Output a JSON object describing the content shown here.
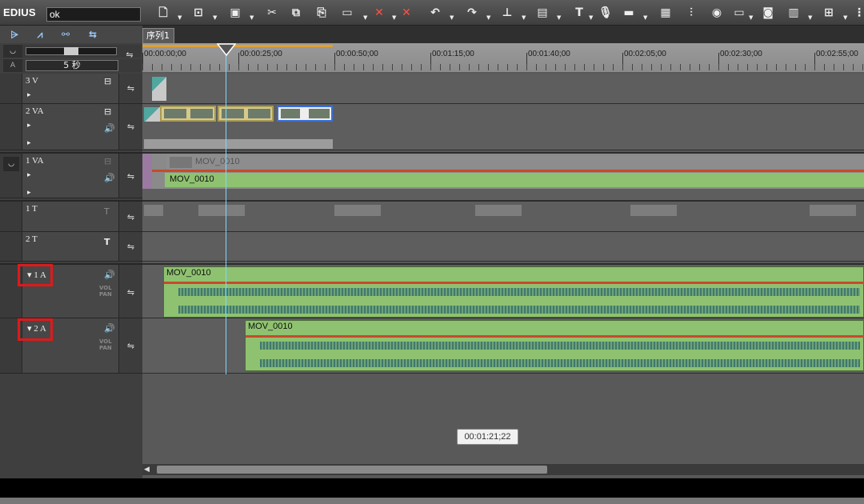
{
  "app": {
    "title": "EDIUS",
    "project_name": "ok"
  },
  "toolbar": {
    "icons": [
      "new-icon",
      "open-icon",
      "save-icon",
      "cut-icon",
      "copy-icon",
      "paste-icon",
      "clip-icon",
      "delete-gap-icon",
      "ripple-delete-icon",
      "undo-icon",
      "redo-icon",
      "marker-icon",
      "render-icon",
      "title-icon",
      "mic-icon",
      "monitor-icon",
      "grid-icon",
      "mixer-icon",
      "color-icon",
      "layout-icon",
      "snapshot-icon",
      "effect-icon",
      "multicam-icon"
    ]
  },
  "sequence_tab": "序列1",
  "header": {
    "zoom_label": "5 秒",
    "zoom_a_label": "A",
    "tracks": [
      {
        "name": "3 V"
      },
      {
        "name": "2 VA"
      },
      {
        "name": "1 VA"
      },
      {
        "name": "1 T"
      },
      {
        "name": "2 T"
      },
      {
        "name": "1 A"
      },
      {
        "name": "2 A"
      }
    ],
    "vol_label": "VOL",
    "pan_label": "PAN"
  },
  "ruler": {
    "ticks": [
      "00:00:00;00",
      "00:00:25;00",
      "00:00:50;00",
      "00:01:15;00",
      "00:01:40;00",
      "00:02:05;00",
      "00:02:30;00",
      "00:02:55;00"
    ]
  },
  "clips": {
    "v1_top": "MOV_0010",
    "v1_bottom": "MOV_0010",
    "a1": "MOV_0010",
    "a2": "MOV_0010"
  },
  "tooltip": "00:01:21;22",
  "colors": {
    "highlight_box": "#e0191b",
    "audio_clip": "#8fc270",
    "playhead": "#7fd7ff"
  }
}
